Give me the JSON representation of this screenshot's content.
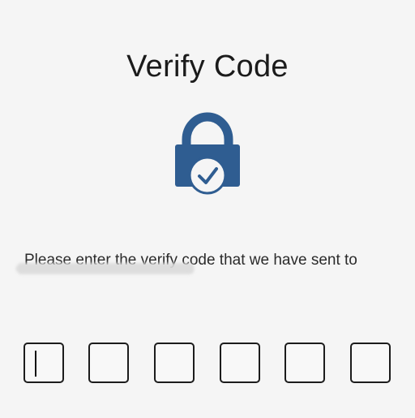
{
  "header": {
    "title": "Verify Code"
  },
  "instruction": {
    "text": "Please enter the verify code that we have sent to"
  },
  "masked_recipient": {
    "label": "redacted contact"
  },
  "code_input": {
    "length": 6,
    "values": [
      "",
      "",
      "",
      "",
      "",
      ""
    ],
    "focused_index": 0
  },
  "icons": {
    "lock": "lock-check-icon"
  },
  "colors": {
    "background": "#f5f5f5",
    "lock_blue": "#2f5d91",
    "text": "#1f1f1f"
  }
}
